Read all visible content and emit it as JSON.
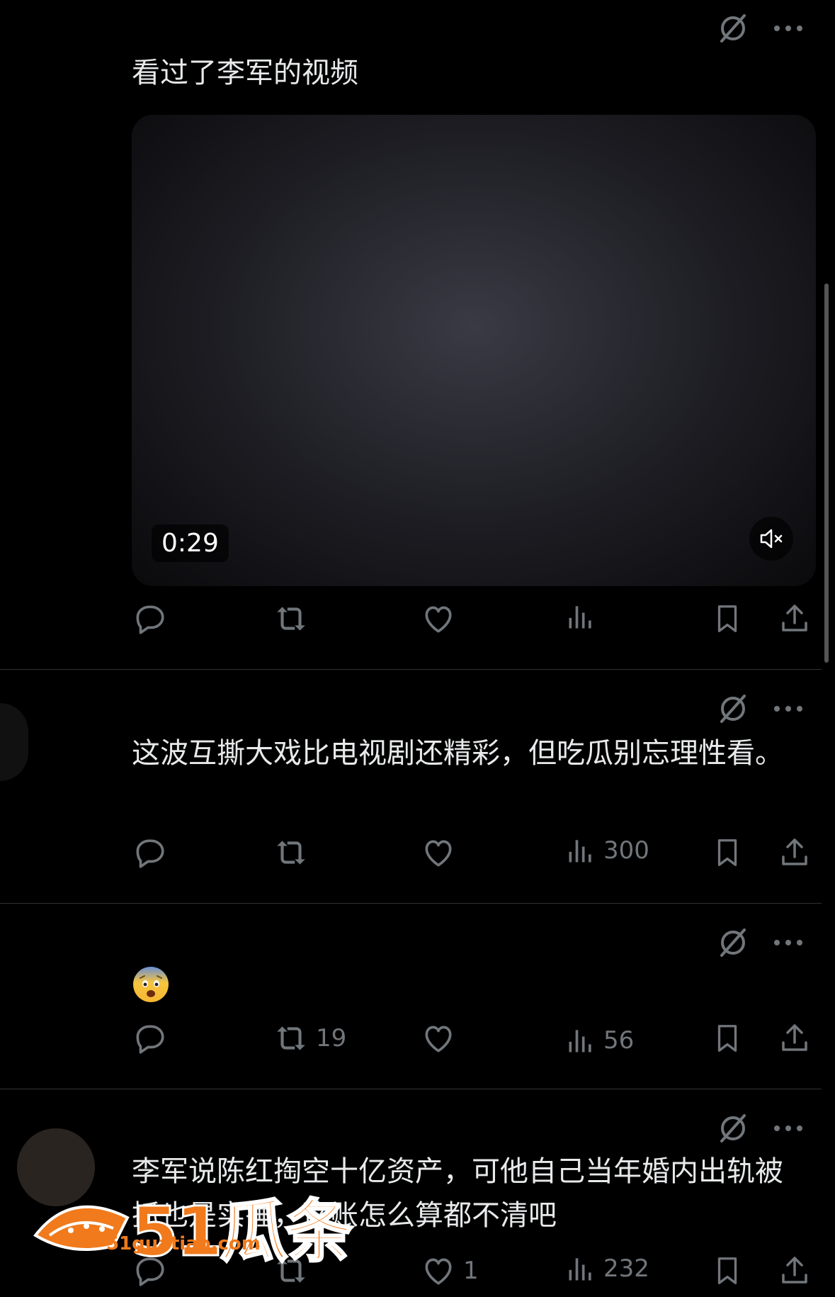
{
  "posts": [
    {
      "text": "看过了李军的视频",
      "video": {
        "duration": "0:29",
        "muted": true
      },
      "stats": {
        "reply": "",
        "repost": "",
        "like": "",
        "views": ""
      }
    },
    {
      "text": "这波互撕大戏比电视剧还精彩，但吃瓜别忘理性看。",
      "stats": {
        "reply": "",
        "repost": "",
        "like": "",
        "views": "300"
      }
    },
    {
      "text": "",
      "emoji": "anxious-face-with-sweat",
      "stats": {
        "reply": "",
        "repost": "19",
        "like": "",
        "views": "56"
      }
    },
    {
      "text": "李军说陈红掏空十亿资产，可他自己当年婚内出轨被抓也是实锤，这账怎么算都不清吧",
      "stats": {
        "reply": "",
        "repost": "",
        "like": "1",
        "views": "232"
      }
    }
  ],
  "watermark": {
    "brand": "51瓜条",
    "url": "51guatiao.com",
    "color": "#f07a1c"
  },
  "colors": {
    "background": "#000000",
    "text": "#e7e9ea",
    "muted": "#71767b",
    "divider": "#2f3336"
  },
  "icons": [
    "grok-icon",
    "more-icon",
    "reply-icon",
    "repost-icon",
    "like-icon",
    "views-icon",
    "bookmark-icon",
    "share-icon",
    "mute-icon"
  ]
}
